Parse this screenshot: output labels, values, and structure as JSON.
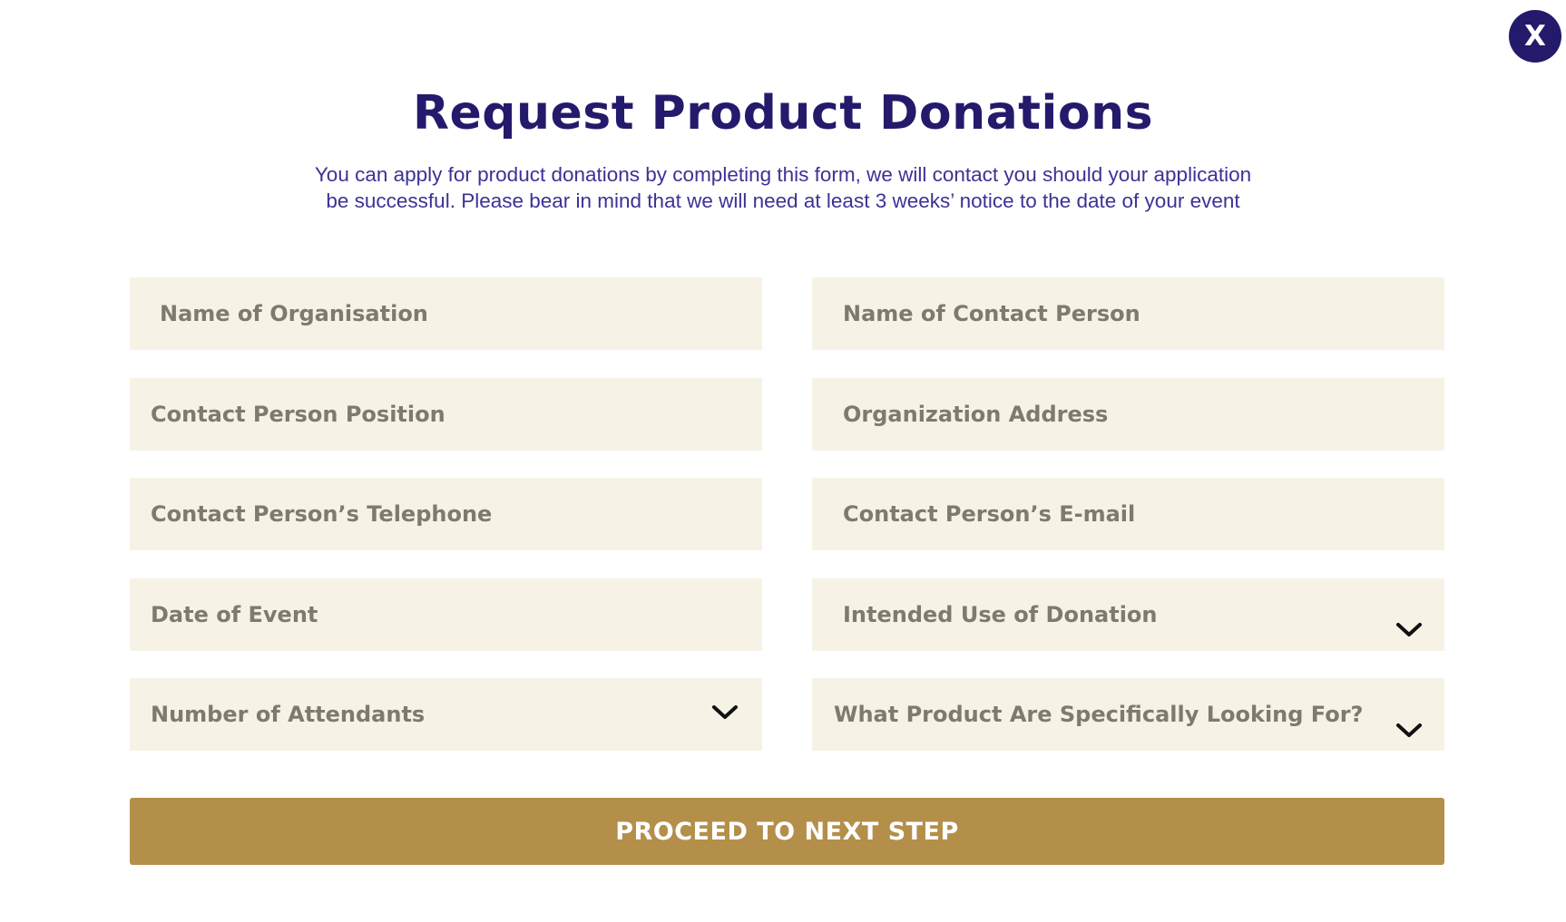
{
  "close_button": {
    "label": "X"
  },
  "header": {
    "title": "Request Product Donations",
    "subtitle_line1": "You can apply for product donations by completing this form, we will contact you should your application",
    "subtitle_line2": "be successful. Please bear in mind that we will need at least 3 weeks’ notice to the date of your event"
  },
  "form": {
    "fields": [
      {
        "label": "Name of Organisation",
        "type": "text"
      },
      {
        "label": "Name of Contact Person",
        "type": "text"
      },
      {
        "label": "Contact Person Position",
        "type": "text"
      },
      {
        "label": "Organization Address",
        "type": "text"
      },
      {
        "label": "Contact Person’s Telephone",
        "type": "text"
      },
      {
        "label": "Contact Person’s E-mail",
        "type": "text"
      },
      {
        "label": "Date of Event",
        "type": "text"
      },
      {
        "label": "Intended Use of Donation",
        "type": "select"
      },
      {
        "label": "Number of Attendants",
        "type": "select"
      },
      {
        "label": "What Product Are Specifically Looking For?",
        "type": "select"
      }
    ],
    "submit_label": "PROCEED TO NEXT STEP"
  },
  "colors": {
    "brand_navy": "#241a6c",
    "subtitle_text": "#3b3394",
    "field_background": "#f6f3e6",
    "field_label": "#7d7a6e",
    "submit_gold": "#b38f4a"
  },
  "icons": {
    "close": "close-icon",
    "dropdown": "chevron-down-icon"
  }
}
